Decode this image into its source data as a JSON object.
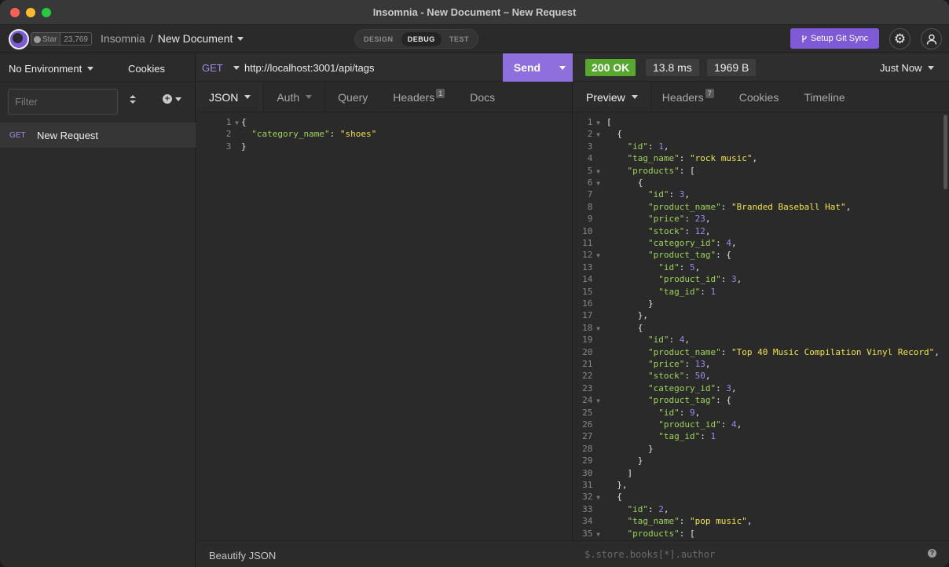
{
  "window": {
    "title": "Insomnia - New Document – New Request"
  },
  "header": {
    "github_star_label": "Star",
    "github_star_count": "23,769",
    "breadcrumb_app": "Insomnia",
    "breadcrumb_sep": "/",
    "breadcrumb_doc": "New Document",
    "modes": [
      "DESIGN",
      "DEBUG",
      "TEST"
    ],
    "active_mode": "DEBUG",
    "git_sync_label": "Setup Git Sync",
    "accent_color": "#7e5ad6"
  },
  "sidebar": {
    "environment": "No Environment",
    "cookies": "Cookies",
    "filter_placeholder": "Filter",
    "requests": [
      {
        "method": "GET",
        "name": "New Request"
      }
    ]
  },
  "request": {
    "method": "GET",
    "url": "http://localhost:3001/api/tags",
    "send_label": "Send",
    "tabs": [
      {
        "label": "JSON",
        "badge": ""
      },
      {
        "label": "Auth",
        "badge": ""
      },
      {
        "label": "Query",
        "badge": ""
      },
      {
        "label": "Headers",
        "badge": "1"
      },
      {
        "label": "Docs",
        "badge": ""
      }
    ],
    "body_lines": [
      "{",
      "  \"category_name\": \"shoes\"",
      "}"
    ],
    "footer_action": "Beautify JSON"
  },
  "response": {
    "status": "200 OK",
    "status_color": "#58a830",
    "time": "13.8 ms",
    "size": "1969 B",
    "when": "Just Now",
    "tabs": [
      {
        "label": "Preview",
        "badge": ""
      },
      {
        "label": "Headers",
        "badge": "7"
      },
      {
        "label": "Cookies",
        "badge": ""
      },
      {
        "label": "Timeline",
        "badge": ""
      }
    ],
    "body_lines": [
      "[",
      "  {",
      "    \"id\": 1,",
      "    \"tag_name\": \"rock music\",",
      "    \"products\": [",
      "      {",
      "        \"id\": 3,",
      "        \"product_name\": \"Branded Baseball Hat\",",
      "        \"price\": 23,",
      "        \"stock\": 12,",
      "        \"category_id\": 4,",
      "        \"product_tag\": {",
      "          \"id\": 5,",
      "          \"product_id\": 3,",
      "          \"tag_id\": 1",
      "        }",
      "      },",
      "      {",
      "        \"id\": 4,",
      "        \"product_name\": \"Top 40 Music Compilation Vinyl Record\",",
      "        \"price\": 13,",
      "        \"stock\": 50,",
      "        \"category_id\": 3,",
      "        \"product_tag\": {",
      "          \"id\": 9,",
      "          \"product_id\": 4,",
      "          \"tag_id\": 1",
      "        }",
      "      }",
      "    ]",
      "  },",
      "  {",
      "    \"id\": 2,",
      "    \"tag_name\": \"pop music\",",
      "    \"products\": ["
    ],
    "fold_lines": [
      1,
      2,
      5,
      6,
      12,
      18,
      24,
      32,
      35
    ],
    "filter_placeholder": "$.store.books[*].author"
  }
}
